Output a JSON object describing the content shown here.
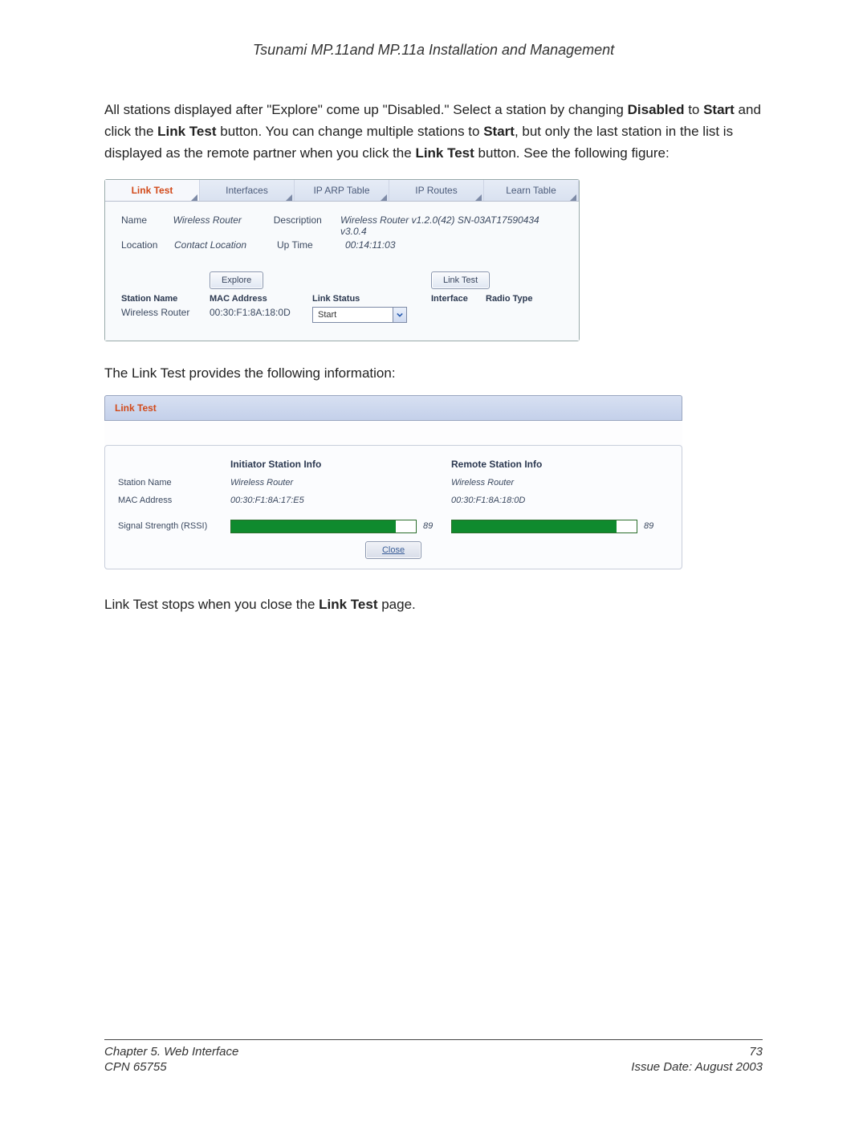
{
  "document_title": "Tsunami MP.11and MP.11a Installation and Management",
  "para1": {
    "t1": "All stations displayed after \"Explore\" come up \"Disabled.\"  Select a station by changing ",
    "b1": "Disabled",
    "t2": " to ",
    "b2": "Start",
    "t3": " and click the ",
    "b3": "Link Test",
    "t4": " button.  You can change multiple stations to ",
    "b4": "Start",
    "t5": ", but only the last station in the list is displayed as the remote partner when you click the ",
    "b5": "Link Test",
    "t6": " button.  See the following figure:"
  },
  "fig1": {
    "tabs": [
      "Link Test",
      "Interfaces",
      "IP ARP Table",
      "IP Routes",
      "Learn Table"
    ],
    "name_label": "Name",
    "name_value": "Wireless Router",
    "desc_label": "Description",
    "desc_value": "Wireless Router v1.2.0(42) SN-03AT17590434 v3.0.4",
    "loc_label": "Location",
    "loc_value": "Contact Location",
    "uptime_label": "Up Time",
    "uptime_value": "00:14:11:03",
    "explore_btn": "Explore",
    "linktest_btn": "Link Test",
    "cols": {
      "station": "Station Name",
      "mac": "MAC Address",
      "status": "Link Status",
      "iface": "Interface",
      "radio": "Radio Type"
    },
    "row": {
      "station": "Wireless Router",
      "mac": "00:30:F1:8A:18:0D",
      "status": "Start"
    }
  },
  "mid_text": "The Link Test provides the following information:",
  "fig2": {
    "tab": "Link Test",
    "labels": {
      "station": "Station Name",
      "mac": "MAC Address",
      "rssi": "Signal Strength (RSSI)"
    },
    "initiator": {
      "head": "Initiator Station Info",
      "station": "Wireless Router",
      "mac": "00:30:F1:8A:17:E5",
      "rssi_value": "89",
      "rssi_pct": 89
    },
    "remote": {
      "head": "Remote Station Info",
      "station": "Wireless Router",
      "mac": "00:30:F1:8A:18:0D",
      "rssi_value": "89",
      "rssi_pct": 89
    },
    "close_btn": "Close"
  },
  "para2": {
    "t1": "Link Test stops when you close the ",
    "b1": "Link Test",
    "t2": " page."
  },
  "footer": {
    "chapter": "Chapter 5.  Web Interface",
    "cpn": "CPN 65755",
    "page": "73",
    "issue": "Issue Date:  August 2003"
  }
}
